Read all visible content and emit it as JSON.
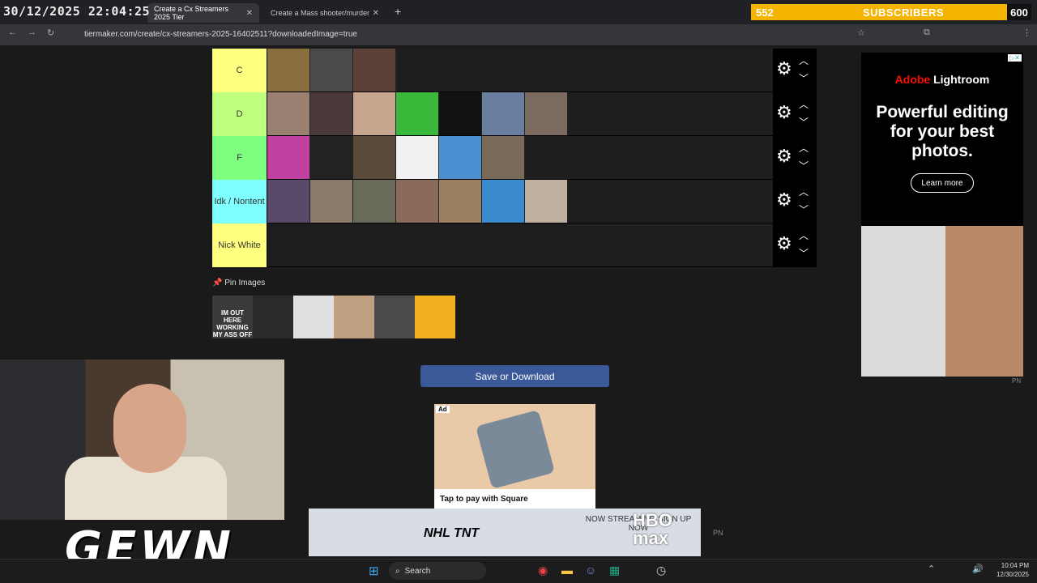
{
  "overlay": {
    "timestamp": "30/12/2025 22:04:25",
    "subscribers": {
      "current": "552",
      "label": "SUBSCRIBERS",
      "goal": "600"
    },
    "logo": "GEWN"
  },
  "browser": {
    "tabs": [
      {
        "title": "Create a Cx Streamers 2025 Tier",
        "active": true
      },
      {
        "title": "Create a Mass shooter/murder",
        "active": false
      }
    ],
    "new_tab": "+",
    "url": "tiermaker.com/create/cx-streamers-2025-16402511?downloadedImage=true"
  },
  "tierlist": {
    "tiers": [
      {
        "label": "C",
        "color": "#ffff7f",
        "thumbs": [
          "#8a6f3e",
          "#4a4a4a",
          "#5a4038"
        ]
      },
      {
        "label": "D",
        "color": "#bfff7f",
        "thumbs": [
          "#9a8070",
          "#4a3a3a",
          "#c6a58e",
          "#3ab83a",
          "#111111",
          "#6a7fa0",
          "#7a6a60"
        ]
      },
      {
        "label": "F",
        "color": "#7fff7f",
        "thumbs": [
          "#c040a0",
          "#222222",
          "#5a4a3a",
          "#f0f0f0",
          "#4a90d0",
          "#7a6a5a"
        ]
      },
      {
        "label": "Idk / Nontent",
        "color": "#7fffff",
        "thumbs": [
          "#5a4a6a",
          "#8a7a6a",
          "#6a6a5a",
          "#8a6a5a",
          "#9a8060",
          "#3a8ad0",
          "#c0b0a0"
        ]
      },
      {
        "label": "Nick White",
        "color": "#ffff7f",
        "thumbs": []
      }
    ],
    "pin_label": "Pin Images",
    "pin_thumbs": [
      {
        "color": "#3a3a3a",
        "caption": "IM OUT HERE WORKING MY ASS OFF"
      },
      {
        "color": "#2a2a2a",
        "caption": ""
      },
      {
        "color": "#e0e0e0",
        "caption": ""
      },
      {
        "color": "#c0a080",
        "caption": ""
      },
      {
        "color": "#4a4a4a",
        "caption": ""
      },
      {
        "color": "#f0b020",
        "caption": ""
      }
    ],
    "save_button": "Save or Download"
  },
  "ads": {
    "right": {
      "brand_a": "Adobe",
      "brand_b": " Lightroom",
      "headline": "Powerful editing for your best photos.",
      "cta": "Learn more",
      "badge": "PN"
    },
    "middle": {
      "tag": "Ad",
      "caption": "Tap to pay with Square"
    },
    "banner": {
      "left": "NHL TNT",
      "mid": "NOW STREAMING SIGN UP NOW",
      "right": "HBO max",
      "badge": "PN"
    }
  },
  "taskbar": {
    "search": "Search",
    "time": "10:04 PM",
    "date": "12/30/2025"
  }
}
